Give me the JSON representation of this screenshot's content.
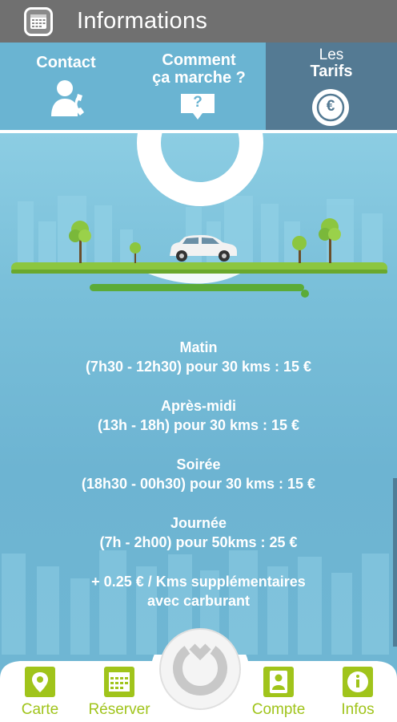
{
  "header": {
    "title": "Informations",
    "icon": "calendar-icon"
  },
  "tabs": {
    "contact": {
      "label": "Contact",
      "icon": "contact-phone-icon"
    },
    "how": {
      "line1": "Comment",
      "line2": "ça marche ?",
      "icon": "question-bubble-icon",
      "icon_text": "?"
    },
    "tarifs": {
      "line1": "Les",
      "line2": "Tarifs",
      "icon": "euro-icon",
      "icon_text": "€",
      "active": true
    }
  },
  "prices": [
    {
      "title": "Matin",
      "detail": "(7h30 - 12h30) pour 30 kms : 15 €"
    },
    {
      "title": "Après-midi",
      "detail": "(13h - 18h) pour 30 kms : 15 €"
    },
    {
      "title": "Soirée",
      "detail": "(18h30 - 00h30) pour 30 kms : 15 €"
    },
    {
      "title": "Journée",
      "detail": "(7h - 2h00) pour 50kms : 25 €"
    },
    {
      "title": "+ 0.25 € / Kms supplémentaires",
      "detail": "avec carburant"
    }
  ],
  "bottom_nav": {
    "carte": {
      "label": "Carte",
      "icon": "map-pin-icon"
    },
    "reserver": {
      "label": "Réserver",
      "icon": "calendar-icon"
    },
    "compte": {
      "label": "Compte",
      "icon": "user-icon"
    },
    "infos": {
      "label": "Infos",
      "icon": "info-icon",
      "active": true
    }
  },
  "colors": {
    "header_bg": "#707070",
    "tab_bg": "#6ab4d2",
    "tab_active_bg": "#547a93",
    "main_bg": "#6fb6d3",
    "accent_green": "#a0c41b",
    "nav_bg": "#ffffff"
  }
}
